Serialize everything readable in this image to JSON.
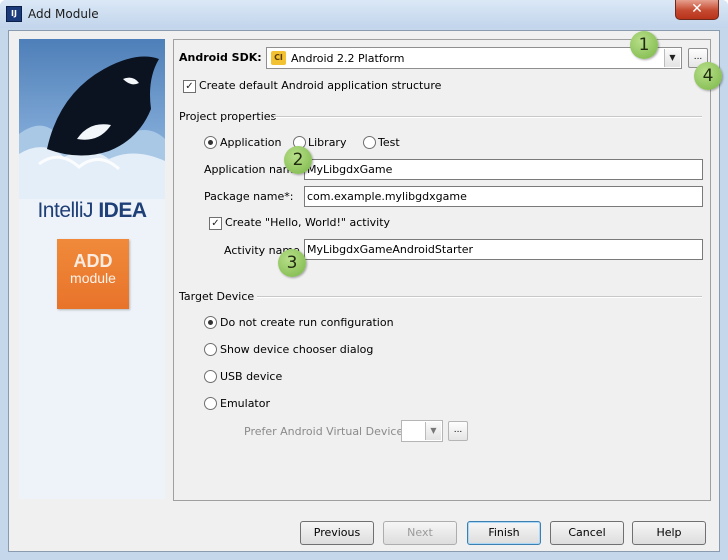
{
  "window": {
    "title": "Add Module",
    "close_glyph": "✕",
    "app_icon_text": "IJ"
  },
  "sidebar": {
    "brand_prefix": "IntelliJ",
    "brand_suffix": "IDEA",
    "add_line1": "ADD",
    "add_line2": "module"
  },
  "sdk": {
    "label": "Android SDK:",
    "value": "Android 2.2 Platform",
    "icon_text": "CI",
    "dots": "...",
    "create_structure_label": "Create default Android application structure",
    "create_structure_checked": true
  },
  "project": {
    "group_title": "Project properties",
    "types": [
      "Application",
      "Library",
      "Test"
    ],
    "selected_type": "Application",
    "app_name_label": "Application name:",
    "app_name_value": "MyLibgdxGame",
    "package_label": "Package name*:",
    "package_value": "com.example.mylibgdxgame",
    "hello_label": "Create \"Hello, World!\" activity",
    "hello_checked": true,
    "activity_label": "Activity name",
    "activity_value": "MyLibgdxGameAndroidStarter"
  },
  "target": {
    "group_title": "Target Device",
    "options": [
      "Do not create run configuration",
      "Show device chooser dialog",
      "USB device",
      "Emulator"
    ],
    "selected": "Do not create run configuration",
    "avd_label": "Prefer Android Virtual Device:",
    "avd_dots": "..."
  },
  "badges": [
    "1",
    "2",
    "3",
    "4"
  ],
  "buttons": {
    "previous": "Previous",
    "next": "Next",
    "finish": "Finish",
    "cancel": "Cancel",
    "help": "Help"
  }
}
